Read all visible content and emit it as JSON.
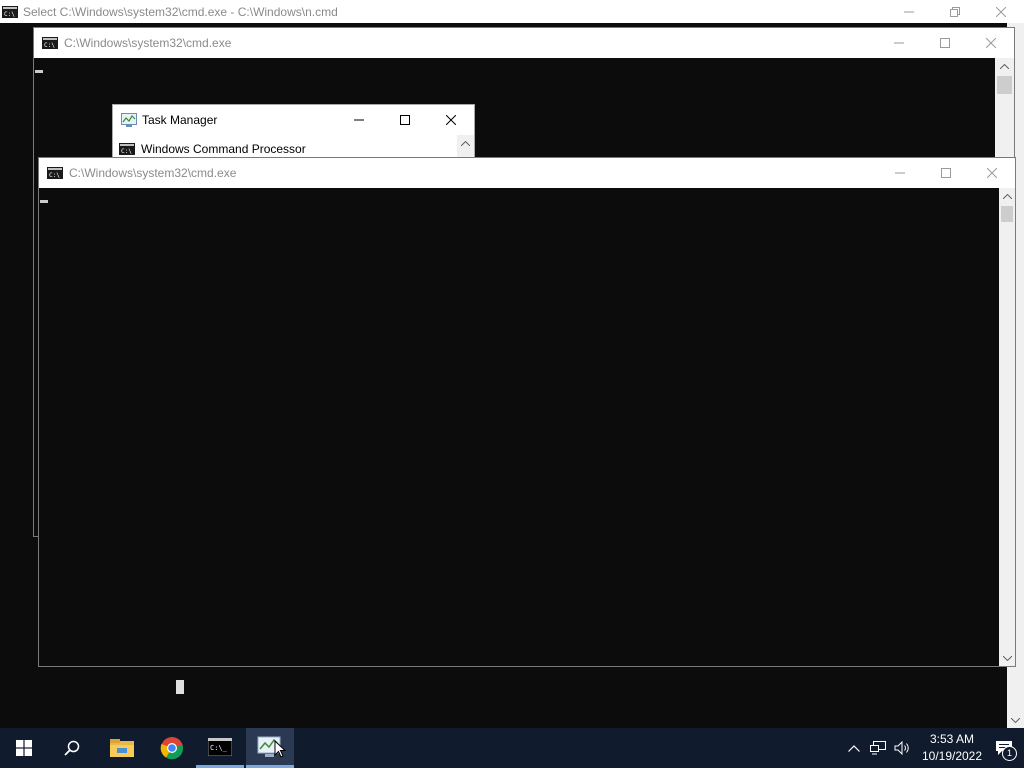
{
  "background_console": {
    "title": "Select C:\\Windows\\system32\\cmd.exe - C:\\Windows\\n.cmd"
  },
  "cmd_window_1": {
    "title": "C:\\Windows\\system32\\cmd.exe"
  },
  "task_manager": {
    "title": "Task Manager",
    "items": [
      "Windows Command Processor"
    ]
  },
  "cmd_window_2": {
    "title": "C:\\Windows\\system32\\cmd.exe"
  },
  "taskbar": {
    "apps": [
      "start-icon",
      "search-icon",
      "file-explorer-icon",
      "chrome-icon",
      "cmd-icon",
      "task-manager-icon"
    ],
    "time": "3:53 AM",
    "date": "10/19/2022",
    "notification_count": "1"
  },
  "colors": {
    "console_bg": "#0c0c0c",
    "taskbar_bg": "#101b2e",
    "titlebar_bg": "#ffffff"
  }
}
